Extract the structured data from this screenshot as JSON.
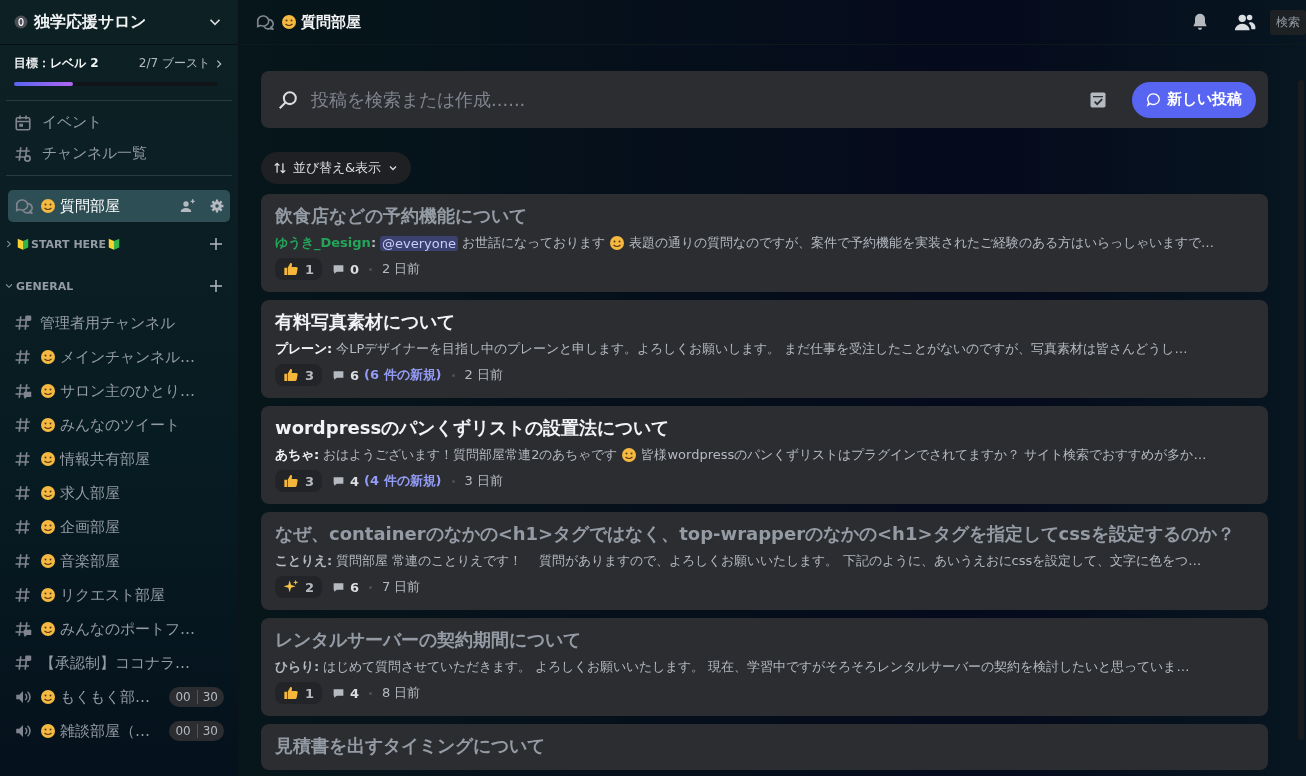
{
  "server": {
    "name": "独学応援サロン",
    "boost_goal": "目標：レベル 2",
    "boost_count": "2/7 ブースト",
    "level": 0.29
  },
  "nav": [
    {
      "kind": "events",
      "label": "イベント"
    },
    {
      "kind": "browse",
      "label": "チャンネル一覧"
    }
  ],
  "current_channel": {
    "kind": "forum",
    "name": "質問部屋",
    "emoji": true,
    "selected": true
  },
  "categories": [
    {
      "name": "START HERE",
      "emoji_before": true,
      "emoji_after": true,
      "expanded": false
    },
    {
      "name": "GENERAL",
      "emoji_before": false,
      "emoji_after": false,
      "expanded": true,
      "channels": [
        {
          "kind": "locked",
          "name": "管理者用チャンネル",
          "emoji": false,
          "selected": false
        },
        {
          "kind": "text",
          "name": "メインチャンネル…",
          "emoji": true,
          "selected": false
        },
        {
          "kind": "forum",
          "name": "サロン主のひとり…",
          "emoji": true,
          "selected": false
        },
        {
          "kind": "text",
          "name": "みんなのツイート",
          "emoji": true,
          "selected": false
        },
        {
          "kind": "text",
          "name": "情報共有部屋",
          "emoji": true,
          "selected": false
        },
        {
          "kind": "text",
          "name": "求人部屋",
          "emoji": true,
          "selected": false
        },
        {
          "kind": "text",
          "name": "企画部屋",
          "emoji": true,
          "selected": false
        },
        {
          "kind": "text",
          "name": "音楽部屋",
          "emoji": true,
          "selected": false
        },
        {
          "kind": "text",
          "name": "リクエスト部屋",
          "emoji": true,
          "selected": false
        },
        {
          "kind": "forum",
          "name": "みんなのポートフ…",
          "emoji": true,
          "selected": false
        },
        {
          "kind": "locked",
          "name": "【承認制】ココナラ…",
          "emoji": false,
          "selected": false
        },
        {
          "kind": "voice",
          "name": "もくもく部…",
          "emoji": true,
          "selected": false,
          "users": "00",
          "limit": "30"
        },
        {
          "kind": "voice",
          "name": "雑談部屋（…",
          "emoji": true,
          "selected": false,
          "users": "00",
          "limit": "30"
        }
      ]
    }
  ],
  "header": {
    "title": "質問部屋",
    "emoji": true,
    "search": "検索"
  },
  "search": {
    "placeholder": "投稿を検索または作成......",
    "new_post": "新しい投稿"
  },
  "sort": {
    "label": "並び替え&表示"
  },
  "posts": [
    {
      "title": "飲食店などの予約機能について",
      "read": true,
      "author": "ゆうき_Design",
      "color": "#23a55a",
      "separator": ":",
      "body": [
        {
          "kind": "mention",
          "text": "@everyone"
        },
        {
          "kind": "text",
          "text": "お世話になっております"
        },
        {
          "kind": "emoji"
        },
        {
          "kind": "text",
          "text": "表題の通りの質問なのですが、案件で予約機能を実装されたご経験のある方はいらっしゃいますで…"
        }
      ],
      "reaction": {
        "kind": "thumb",
        "count": "1"
      },
      "comments": "0",
      "time": "2 日前"
    },
    {
      "title": "有料写真素材について",
      "read": false,
      "author": "プレーン",
      "separator": ":",
      "body": [
        {
          "kind": "text",
          "text": "今LPデザイナーを目指し中のプレーンと申します。よろしくお願いします。 まだ仕事を受注したことがないのですが、写真素材は皆さんどうし…"
        }
      ],
      "reaction": {
        "kind": "thumb",
        "count": "3"
      },
      "comments": "6",
      "new": "(6 件の新規)",
      "time": "2 日前"
    },
    {
      "title": "wordpressのパンくずリストの設置法について",
      "read": false,
      "author": "あちゃ",
      "separator": ":",
      "body": [
        {
          "kind": "text",
          "text": "おはようございます！質問部屋常連2のあちゃです"
        },
        {
          "kind": "emoji"
        },
        {
          "kind": "text",
          "text": "皆様wordpressのパンくずリストはプラグインでされてますか？ サイト検索でおすすめが多か…"
        }
      ],
      "reaction": {
        "kind": "thumb",
        "count": "3"
      },
      "comments": "4",
      "new": "(4 件の新規)",
      "time": "3 日前"
    },
    {
      "title": "なぜ、containerのなかの<h1>タグではなく、top-wrapperのなかの<h1>タグを指定してcssを設定するのか？",
      "read": true,
      "author": "ことりえ",
      "separator": ":",
      "body": [
        {
          "kind": "text",
          "text": "質問部屋 常連のことりえです！　 質問がありますので、よろしくお願いいたします。 下記のように、あいうえおにcssを設定して、文字に色をつ…"
        }
      ],
      "reaction": {
        "kind": "sparkle",
        "count": "2"
      },
      "comments": "6",
      "time": "7 日前"
    },
    {
      "title": "レンタルサーバーの契約期間について",
      "read": true,
      "author": "ひらり",
      "separator": ":",
      "body": [
        {
          "kind": "text",
          "text": "はじめて質問させていただきます。 よろしくお願いいたします。 現在、学習中ですがそろそろレンタルサーバーの契約を検討したいと思っていま…"
        }
      ],
      "reaction": {
        "kind": "thumb",
        "count": "1"
      },
      "comments": "4",
      "time": "8 日前"
    },
    {
      "title": "見積書を出すタイミングについて",
      "read": true
    }
  ]
}
